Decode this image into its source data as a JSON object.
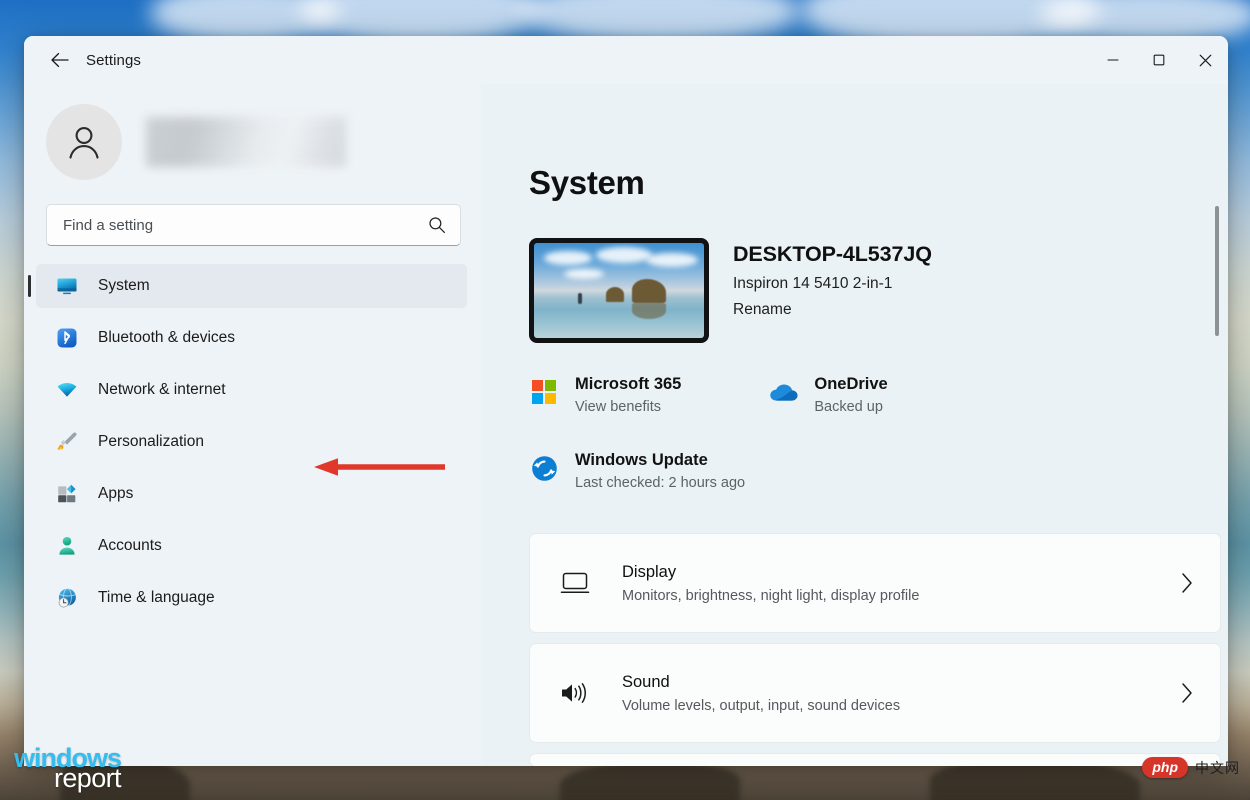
{
  "window": {
    "title": "Settings",
    "back_icon": "back-arrow-icon",
    "controls": {
      "minimize": "minimize-icon",
      "maximize": "maximize-icon",
      "close": "close-icon"
    }
  },
  "sidebar": {
    "avatar_icon": "person-avatar-icon",
    "account_name": "",
    "search": {
      "placeholder": "Find a setting",
      "value": "",
      "icon": "search-icon"
    },
    "items": [
      {
        "label": "System",
        "icon": "monitor-icon",
        "selected": true
      },
      {
        "label": "Bluetooth & devices",
        "icon": "bluetooth-icon",
        "selected": false
      },
      {
        "label": "Network & internet",
        "icon": "wifi-icon",
        "selected": false
      },
      {
        "label": "Personalization",
        "icon": "paintbrush-icon",
        "selected": false
      },
      {
        "label": "Apps",
        "icon": "apps-blocks-icon",
        "selected": false
      },
      {
        "label": "Accounts",
        "icon": "person-icon",
        "selected": false
      },
      {
        "label": "Time & language",
        "icon": "globe-clock-icon",
        "selected": false
      }
    ]
  },
  "annotation": {
    "type": "red-arrow",
    "points_to": "Bluetooth & devices",
    "color": "#e0392b"
  },
  "main": {
    "page_title": "System",
    "device": {
      "name": "DESKTOP-4L537JQ",
      "model": "Inspiron 14 5410 2-in-1",
      "rename_label": "Rename",
      "thumbnail_icon": "device-wallpaper-thumbnail"
    },
    "quick_status": [
      {
        "title": "Microsoft 365",
        "subtitle": "View benefits",
        "icon": "microsoft-logo-icon"
      },
      {
        "title": "OneDrive",
        "subtitle": "Backed up",
        "icon": "onedrive-cloud-icon"
      },
      {
        "title": "Windows Update",
        "subtitle": "Last checked: 2 hours ago",
        "icon": "windows-update-sync-icon"
      }
    ],
    "cards": [
      {
        "title": "Display",
        "subtitle": "Monitors, brightness, night light, display profile",
        "icon": "display-monitor-icon",
        "chevron": "chevron-right-icon"
      },
      {
        "title": "Sound",
        "subtitle": "Volume levels, output, input, sound devices",
        "icon": "speaker-volume-icon",
        "chevron": "chevron-right-icon"
      }
    ]
  },
  "watermarks": {
    "windows_report_primary": "windows",
    "windows_report_secondary": "report",
    "php_badge": "php",
    "php_chinese": "中文网"
  },
  "colors": {
    "window_bg": "#eef3f7",
    "content_bg": "#eaf2f5",
    "card_bg": "#fbfdfc",
    "selected_nav_bg": "#e3e9ee",
    "accent_red": "#e0392b",
    "bluetooth_blue": "#2f7fe0",
    "text_primary": "#101010",
    "text_secondary": "#5d6267"
  }
}
